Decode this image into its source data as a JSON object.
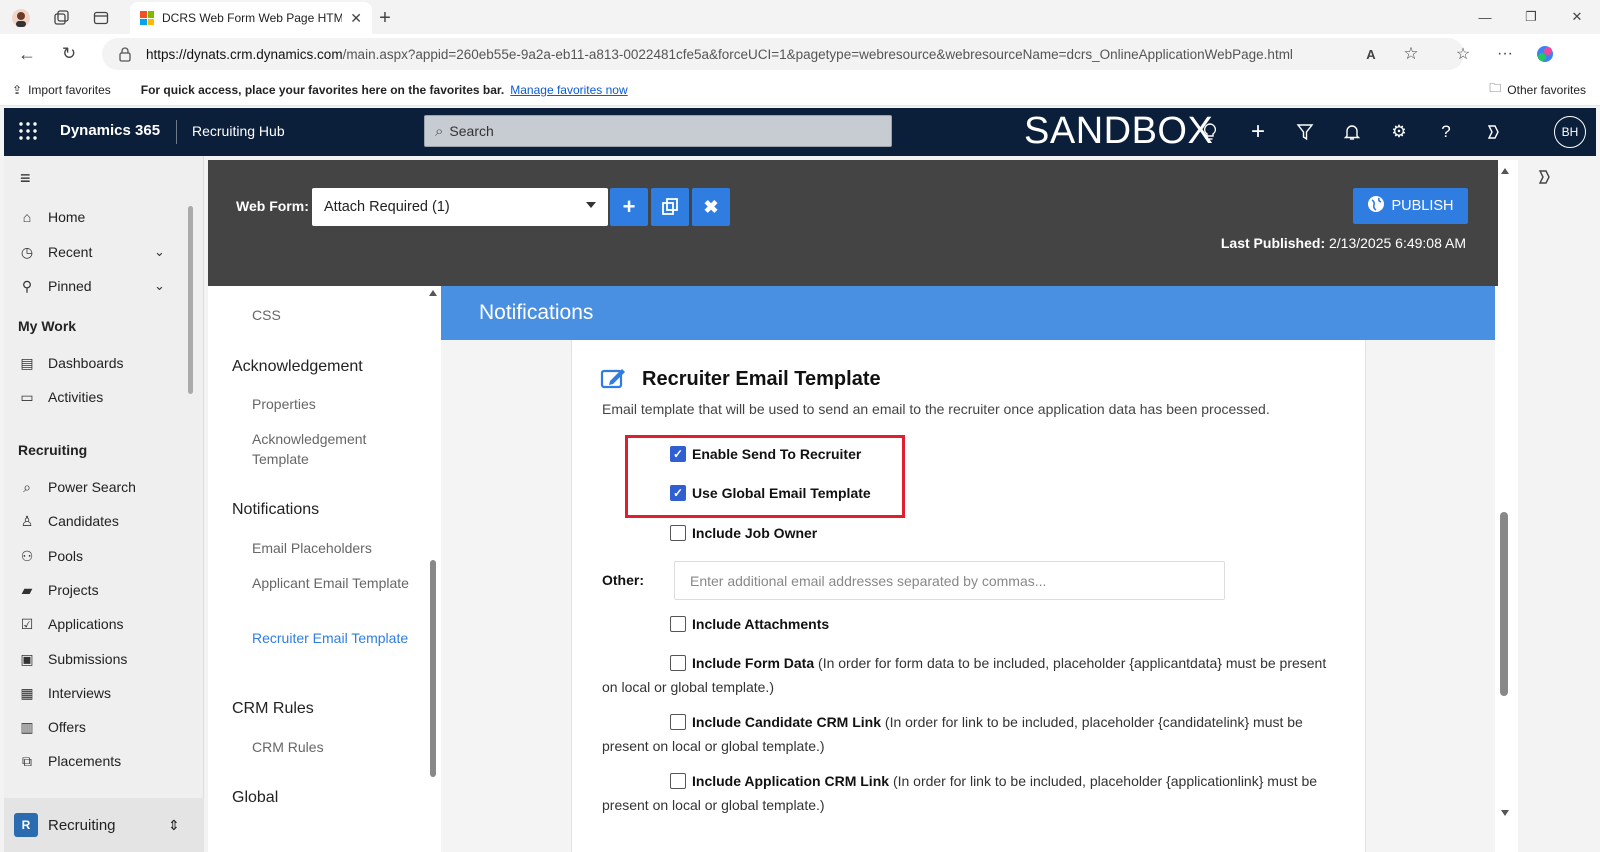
{
  "browser": {
    "tab_title": "DCRS Web Form Web Page HTML",
    "url_host": "https://dynats.crm.dynamics.com",
    "url_path": "/main.aspx?appid=260eb55e-9a2a-eb11-a813-0022481cfe5a&forceUCI=1&pagetype=webresource&webresourceName=dcrs_OnlineApplicationWebPage.html",
    "favbar": {
      "import": "Import favorites",
      "hint": "For quick access, place your favorites here on the favorites bar.",
      "manage": "Manage favorites now",
      "other": "Other favorites"
    }
  },
  "header": {
    "app_name": "Dynamics 365",
    "area": "Recruiting Hub",
    "search_placeholder": "Search",
    "environment": "SANDBOX",
    "avatar": "BH"
  },
  "leftnav": {
    "home": "Home",
    "recent": "Recent",
    "pinned": "Pinned",
    "my_work": "My Work",
    "dashboards": "Dashboards",
    "activities": "Activities",
    "recruiting": "Recruiting",
    "power_search": "Power Search",
    "candidates": "Candidates",
    "pools": "Pools",
    "projects": "Projects",
    "applications": "Applications",
    "submissions": "Submissions",
    "interviews": "Interviews",
    "offers": "Offers",
    "placements": "Placements",
    "area_switch": "Recruiting",
    "area_letter": "R"
  },
  "toolbar": {
    "web_form_label": "Web Form:",
    "web_form_value": "Attach Required (1)",
    "publish": "PUBLISH",
    "last_published_label": "Last Published:",
    "last_published_value": "2/13/2025 6:49:08 AM"
  },
  "secnav": {
    "css": "CSS",
    "acknowledgement": "Acknowledgement",
    "properties": "Properties",
    "ack_template": "Acknowledgement Template",
    "notifications": "Notifications",
    "email_placeholders": "Email Placeholders",
    "applicant_email": "Applicant Email Template",
    "recruiter_email": "Recruiter Email Template",
    "crm_rules_h": "CRM Rules",
    "crm_rules": "CRM Rules",
    "global": "Global"
  },
  "main": {
    "section_title": "Notifications",
    "card_title": "Recruiter Email Template",
    "card_desc": "Email template that will be used to send an email to the recruiter once application data has been processed.",
    "enable_send": "Enable Send To Recruiter",
    "use_global": "Use Global Email Template",
    "include_job_owner": "Include Job Owner",
    "other_label": "Other:",
    "other_placeholder": "Enter additional email addresses separated by commas...",
    "include_attachments": "Include Attachments",
    "include_form_data": "Include Form Data",
    "form_data_note": "(In order for form data to be included, placeholder {applicantdata} must be present on local or global template.)",
    "include_candidate_link": "Include Candidate CRM Link",
    "candidate_link_note": "(In order for link to be included, placeholder {candidatelink} must be present on local or global template.)",
    "include_application_link": "Include Application CRM Link",
    "application_link_note": "(In order for link to be included, placeholder {applicationlink} must be present on local or global template.)"
  },
  "colors": {
    "accent": "#2f7de1",
    "header_bg": "#0b1f3a",
    "highlight": "#e11e2d"
  }
}
